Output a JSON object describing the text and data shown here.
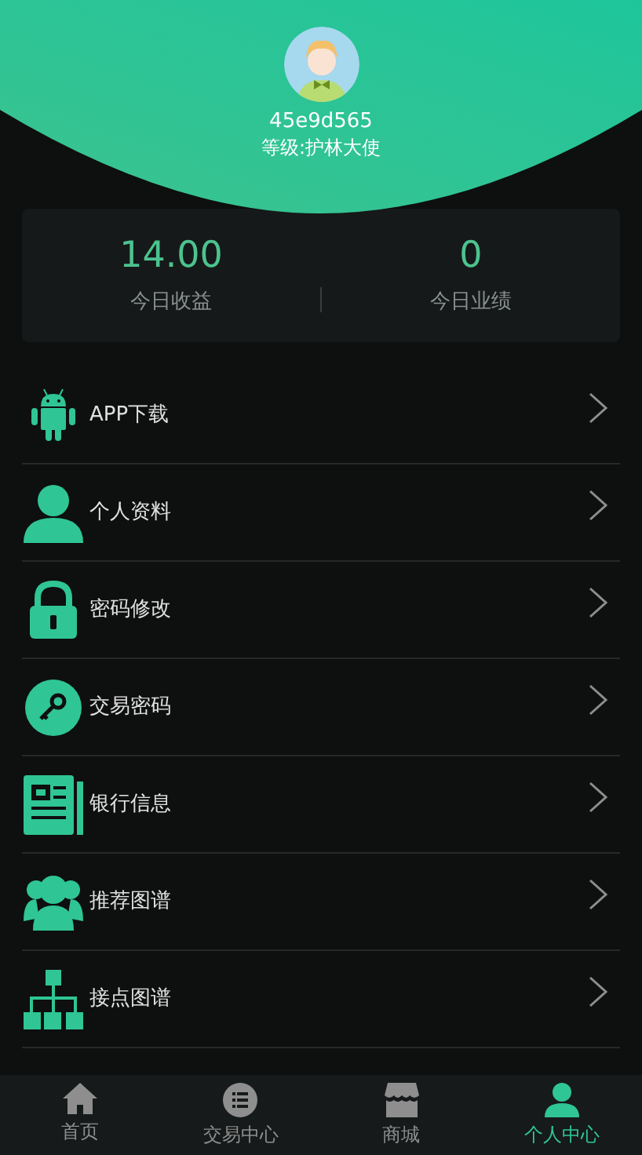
{
  "profile": {
    "username": "45e9d565",
    "level": "等级:护林大使"
  },
  "stats": [
    {
      "value": "14.00",
      "label": "今日收益"
    },
    {
      "value": "0",
      "label": "今日业绩"
    }
  ],
  "menu": [
    {
      "kind": "android",
      "label": "APP下载"
    },
    {
      "kind": "user",
      "label": "个人资料"
    },
    {
      "kind": "lock",
      "label": "密码修改"
    },
    {
      "kind": "key",
      "label": "交易密码"
    },
    {
      "kind": "news",
      "label": "银行信息"
    },
    {
      "kind": "group",
      "label": "推荐图谱"
    },
    {
      "kind": "tree",
      "label": "接点图谱"
    }
  ],
  "tabbar": [
    {
      "kind": "home",
      "label": "首页",
      "selected": false
    },
    {
      "kind": "list",
      "label": "交易中心",
      "selected": false
    },
    {
      "kind": "shop",
      "label": "商城",
      "selected": false
    },
    {
      "kind": "user",
      "label": "个人中心",
      "selected": true
    }
  ]
}
